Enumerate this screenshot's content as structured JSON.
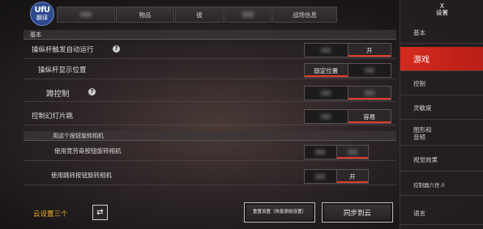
{
  "translate_badge": {
    "logo": "UfU",
    "label": "翻译"
  },
  "tabs": [
    "",
    "物品",
    "拔",
    "",
    "战场信息"
  ],
  "sections": {
    "basic": "基本",
    "camera": "用这个按钮旋转相机"
  },
  "rows": {
    "joystick_auto_run": {
      "label": "操纵杆触发自动运行",
      "right": "开"
    },
    "joystick_position": {
      "label": "操纵杆显示位置",
      "left": "固定位置"
    },
    "crouch": {
      "label": "蹲控制"
    },
    "slide_control": {
      "label": "控制幻灯片跳",
      "right": "容易"
    },
    "aim_rotate": {
      "label": "使用竞劳奇按钮旋转相机"
    },
    "jump_rotate": {
      "label": "使用跳转按钮旋转相机",
      "right": "开"
    }
  },
  "bottom": {
    "cloud_label": "云设置三个",
    "reset_button": "重置设置（恢复原始设置）",
    "sync_button": "同步到云"
  },
  "sidebar": {
    "close": "X",
    "title": "设置",
    "items": [
      "基本",
      "游戏",
      "控制",
      "灵敏度",
      "图形和\n音频",
      "视觉效果",
      "控制器六世.0",
      "语言"
    ],
    "active_index": 1
  },
  "colors": {
    "accent": "#e03a2a",
    "active_tab": "#d42a1e",
    "cloud_label": "#f0b830"
  }
}
